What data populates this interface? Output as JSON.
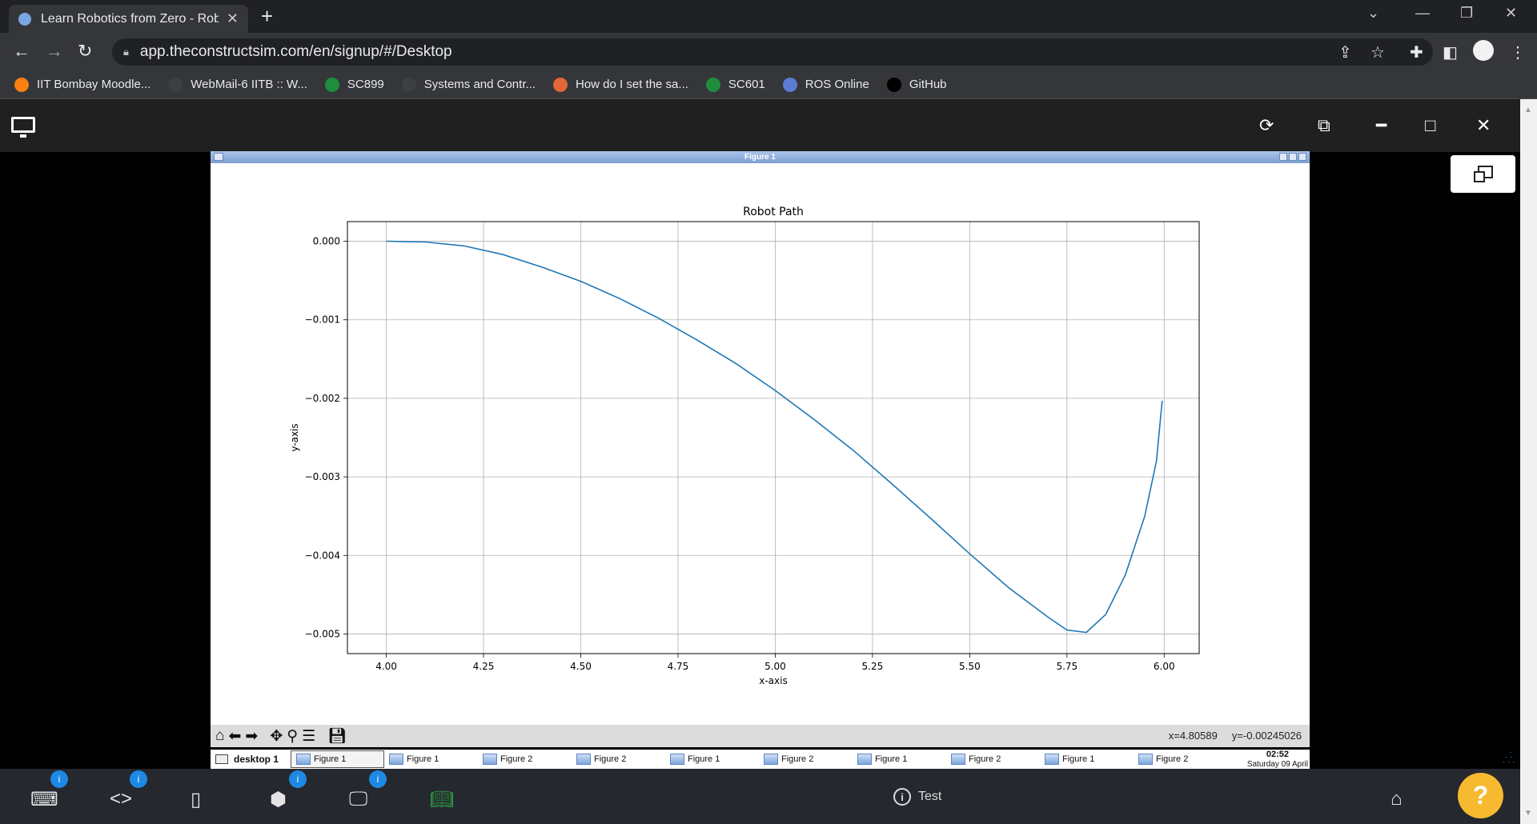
{
  "browser": {
    "tab_title": "Learn Robotics from Zero - Robo",
    "url": "app.theconstructsim.com/en/signup/#/Desktop",
    "bookmarks": [
      {
        "label": "IIT Bombay Moodle...",
        "icon": "moodle-icon",
        "color": "#f98012"
      },
      {
        "label": "WebMail-6 IITB :: W...",
        "icon": "globe-icon",
        "color": "#3c4043"
      },
      {
        "label": "SC899",
        "icon": "classroom-icon",
        "color": "#1e8e3e"
      },
      {
        "label": "Systems and Contr...",
        "icon": "globe-icon",
        "color": "#3c4043"
      },
      {
        "label": "How do I set the sa...",
        "icon": "matlab-icon",
        "color": "#e16737"
      },
      {
        "label": "SC601",
        "icon": "classroom-icon",
        "color": "#1e8e3e"
      },
      {
        "label": "ROS Online",
        "icon": "construct-icon",
        "color": "#5b7bd5"
      },
      {
        "label": "GitHub",
        "icon": "github-icon",
        "color": "#000000"
      }
    ]
  },
  "figure": {
    "window_title": "Figure 1",
    "coords_x": "x=4.80589",
    "coords_y": "y=-0.00245026"
  },
  "chart_data": {
    "type": "line",
    "title": "Robot Path",
    "xlabel": "x-axis",
    "ylabel": "y-axis",
    "xlim": [
      3.9,
      6.09
    ],
    "ylim": [
      -0.00525,
      0.00025
    ],
    "xticks": [
      "4.00",
      "4.25",
      "4.50",
      "4.75",
      "5.00",
      "5.25",
      "5.50",
      "5.75",
      "6.00"
    ],
    "xtick_values": [
      4.0,
      4.25,
      4.5,
      4.75,
      5.0,
      5.25,
      5.5,
      5.75,
      6.0
    ],
    "yticks": [
      "0.000",
      "−0.001",
      "−0.002",
      "−0.003",
      "−0.004",
      "−0.005"
    ],
    "ytick_values": [
      0.0,
      -0.001,
      -0.002,
      -0.003,
      -0.004,
      -0.005
    ],
    "grid": true,
    "line_color": "#1f77b4",
    "series": [
      {
        "x": [
          4.0,
          4.1,
          4.2,
          4.3,
          4.4,
          4.5,
          4.6,
          4.7,
          4.8,
          4.9,
          5.0,
          5.1,
          5.2,
          5.3,
          5.4,
          5.5,
          5.6,
          5.7,
          5.75,
          5.8,
          5.85,
          5.9,
          5.95,
          5.98,
          5.995
        ],
        "y": [
          0.0,
          -1e-05,
          -6e-05,
          -0.00017,
          -0.00033,
          -0.00051,
          -0.00073,
          -0.00098,
          -0.00126,
          -0.00156,
          -0.0019,
          -0.00227,
          -0.00266,
          -0.00309,
          -0.00353,
          -0.00398,
          -0.00441,
          -0.00478,
          -0.00495,
          -0.00498,
          -0.00475,
          -0.00425,
          -0.0035,
          -0.0028,
          -0.00203
        ]
      }
    ]
  },
  "desktop_taskbar": {
    "desktop_label": "desktop 1",
    "windows": [
      "Figure 1",
      "Figure 1",
      "Figure 2",
      "Figure 2",
      "Figure 1",
      "Figure 2",
      "Figure 1",
      "Figure 2",
      "Figure 1",
      "Figure 2"
    ],
    "time": "02:52",
    "date": "Saturday 09 April"
  },
  "appbar": {
    "test_label": "Test",
    "badges": [
      "i",
      "i",
      "i",
      "i"
    ],
    "help": "?"
  },
  "colors": {
    "badge": "#1e88e5",
    "help": "#f7b92f",
    "accent_green": "#2e9e44"
  }
}
